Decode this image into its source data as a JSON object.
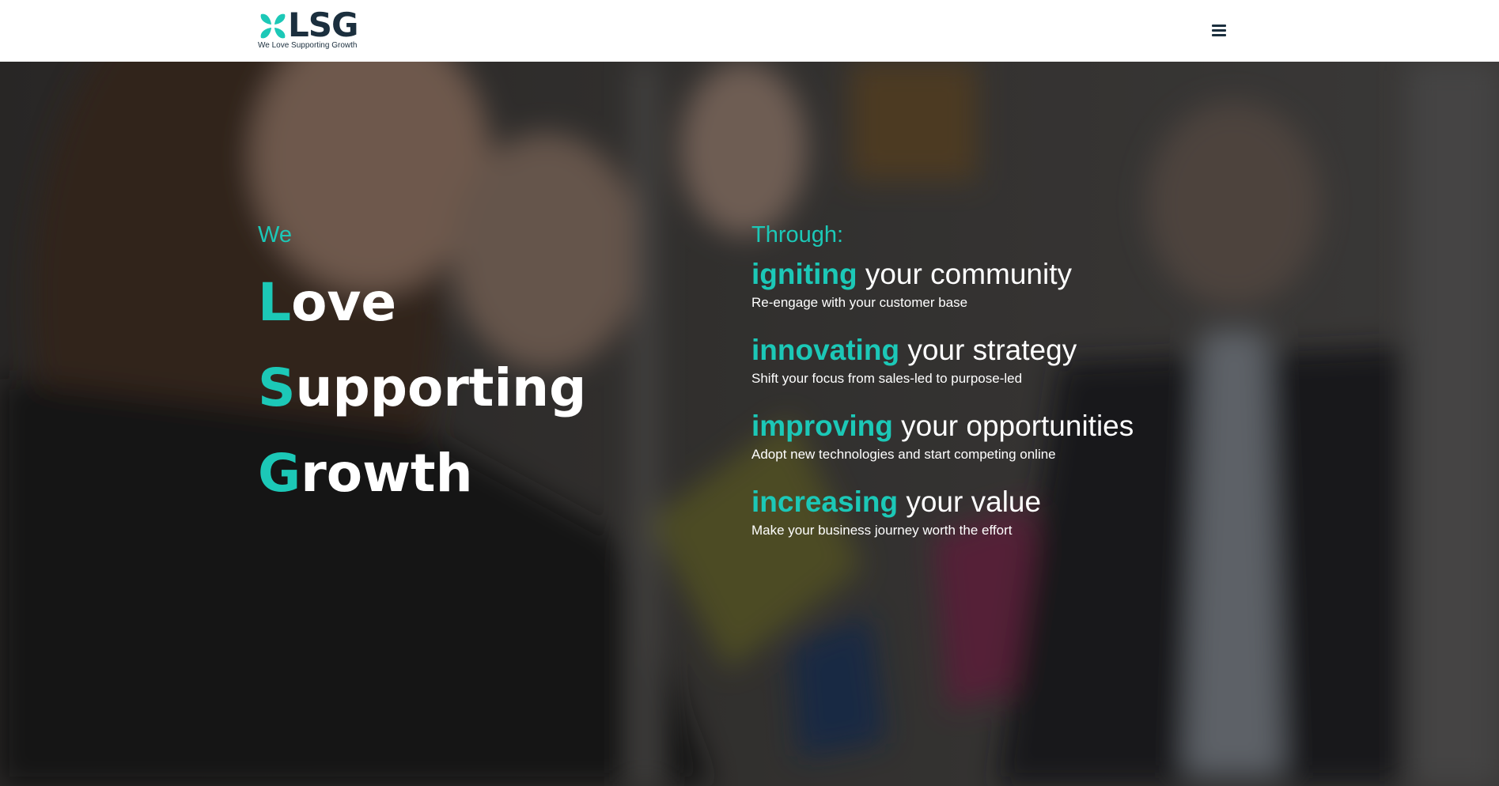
{
  "header": {
    "logo_text": "LSG",
    "logo_tagline": "We Love Supporting Growth",
    "menu_icon": "hamburger-menu-icon"
  },
  "colors": {
    "accent": "#1cc8b7",
    "brand_dark": "#1b2f3e",
    "text_light": "#ffffff"
  },
  "hero": {
    "intro": "We",
    "words": [
      {
        "initial": "L",
        "rest": "ove"
      },
      {
        "initial": "S",
        "rest": "upporting"
      },
      {
        "initial": "G",
        "rest": "rowth"
      }
    ],
    "through_label": "Through:",
    "items": [
      {
        "keyword": "igniting",
        "rest": " your community",
        "description": "Re-engage with your customer base"
      },
      {
        "keyword": "innovating",
        "rest": " your strategy",
        "description": "Shift your focus from sales-led to purpose-led"
      },
      {
        "keyword": "improving",
        "rest": " your opportunities",
        "description": "Adopt new technologies and start competing online"
      },
      {
        "keyword": "increasing",
        "rest": " your value",
        "description": "Make your business journey worth the effort"
      }
    ]
  }
}
